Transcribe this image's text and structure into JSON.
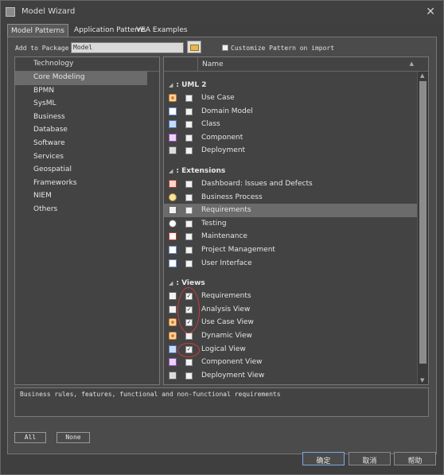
{
  "window": {
    "title": "Model Wizard"
  },
  "tabs": [
    "Model Patterns",
    "Application Patterns",
    "VEA Examples"
  ],
  "package": {
    "label": "Add to Package",
    "value": "Model"
  },
  "customize": {
    "label": "Customize Pattern on import",
    "checked": false
  },
  "technology": {
    "header": "Technology",
    "items": [
      "Core Modeling",
      "BPMN",
      "SysML",
      "Business",
      "Database",
      "Software",
      "Services",
      "Geospatial",
      "Frameworks",
      "NIEM",
      "Others"
    ],
    "selected": "Core Modeling"
  },
  "patterns": {
    "header": "Name",
    "groups": [
      {
        "title": ": UML 2",
        "items": [
          {
            "label": "Use Case",
            "icon": "use-case-icon",
            "checked": false
          },
          {
            "label": "Domain Model",
            "icon": "domain-model-icon",
            "checked": false
          },
          {
            "label": "Class",
            "icon": "class-icon",
            "checked": false
          },
          {
            "label": "Component",
            "icon": "component-icon",
            "checked": false
          },
          {
            "label": "Deployment",
            "icon": "deployment-icon",
            "checked": false
          }
        ]
      },
      {
        "title": ": Extensions",
        "items": [
          {
            "label": "Dashboard: Issues and Defects",
            "icon": "dashboard-icon",
            "checked": false
          },
          {
            "label": "Business Process",
            "icon": "business-process-icon",
            "checked": false
          },
          {
            "label": "Requirements",
            "icon": "requirements-icon",
            "checked": false
          },
          {
            "label": "Testing",
            "icon": "testing-icon",
            "checked": false
          },
          {
            "label": "Maintenance",
            "icon": "maintenance-icon",
            "checked": false
          },
          {
            "label": "Project Management",
            "icon": "document-icon",
            "checked": false
          },
          {
            "label": "User Interface",
            "icon": "document-icon",
            "checked": false
          }
        ]
      },
      {
        "title": ": Views",
        "items": [
          {
            "label": "Requirements",
            "icon": "requirements-icon",
            "checked": true
          },
          {
            "label": "Analysis View",
            "icon": "requirements-icon",
            "checked": true
          },
          {
            "label": "Use Case View",
            "icon": "use-case-icon",
            "checked": true
          },
          {
            "label": "Dynamic View",
            "icon": "use-case-icon",
            "checked": false
          },
          {
            "label": "Logical View",
            "icon": "class-icon",
            "checked": true
          },
          {
            "label": "Component View",
            "icon": "component-icon",
            "checked": false
          },
          {
            "label": "Deployment View",
            "icon": "deployment-icon",
            "checked": false
          }
        ]
      }
    ],
    "selected": "Extensions/Requirements"
  },
  "description": "Business rules, features, functional and non-functional requirements",
  "buttons": {
    "all": "All",
    "none": "None",
    "ok": "确定",
    "cancel": "取消",
    "help": "帮助"
  },
  "colors": {
    "window_bg": "#3f3f3f",
    "panel_bg": "#434343",
    "selection": "#6b6b6b",
    "annotation": "#d13a3a"
  }
}
